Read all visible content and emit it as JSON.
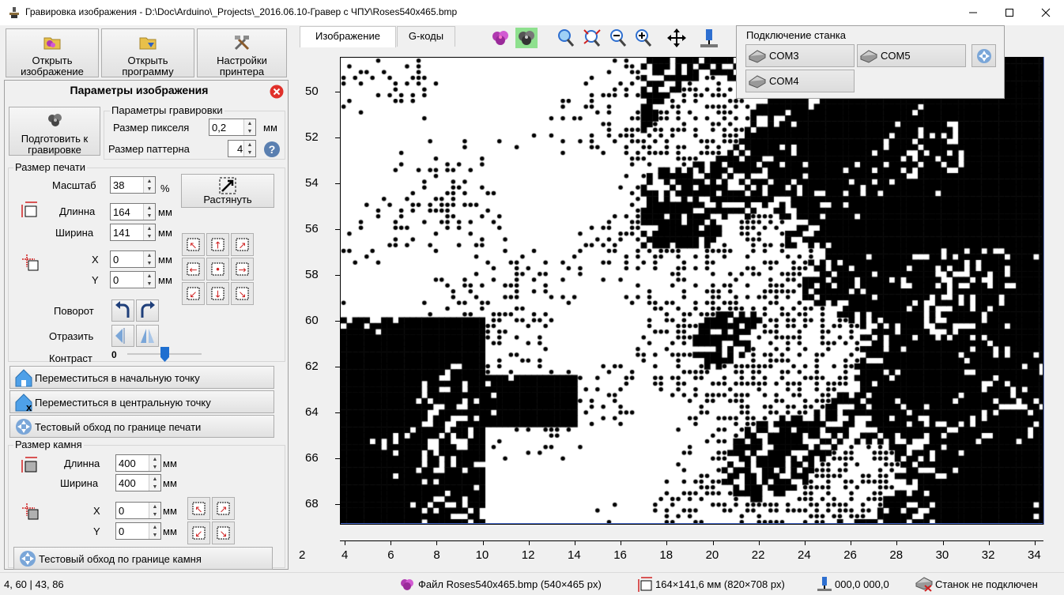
{
  "window": {
    "title": "Гравировка изображения - D:\\Doc\\Arduino\\_Projects\\_2016.06.10-Гравер с ЧПУ\\Roses540x465.bmp"
  },
  "toolbar": {
    "open_image": "Открыть изображение",
    "open_program": "Открыть программу",
    "printer_settings": "Настройки принтера"
  },
  "params": {
    "title": "Параметры изображения",
    "prepare": "Подготовить к гравировке",
    "engrave_group": "Параметры гравировки",
    "pixel_size_label": "Размер пикселя",
    "pixel_size": "0,2",
    "pixel_unit": "мм",
    "pattern_size_label": "Размер паттерна",
    "pattern_size": "4",
    "print_group": "Размер печати",
    "scale_label": "Масштаб",
    "scale": "38",
    "percent": "%",
    "stretch": "Растянуть",
    "length_label": "Длинна",
    "length": "164",
    "width_label": "Ширина",
    "width": "141",
    "mm": "мм",
    "x_label": "X",
    "x": "0",
    "y_label": "Y",
    "y": "0",
    "rotate_label": "Поворот",
    "mirror_label": "Отразить",
    "contrast_label": "Контраст",
    "contrast_value": "0",
    "contrast_level": 0.5,
    "move_start": "Переместиться в начальную точку",
    "move_center": "Переместиться в центральную точку",
    "test_print_border": "Тестовый обход по границе печати",
    "stone_group": "Размер камня",
    "stone_length_label": "Длинна",
    "stone_length": "400",
    "stone_width_label": "Ширина",
    "stone_width": "400",
    "stone_x_label": "X",
    "stone_x": "0",
    "stone_y_label": "Y",
    "stone_y": "0",
    "test_stone_border": "Тестовый обход по границе камня"
  },
  "tabs": [
    "Изображение",
    "G-коды"
  ],
  "machine": {
    "title": "Подключение станка",
    "ports": [
      "COM3",
      "COM5",
      "COM4"
    ]
  },
  "plot": {
    "x_ticks": [
      "4",
      "6",
      "8",
      "10",
      "12",
      "14",
      "16",
      "18",
      "20",
      "22",
      "24",
      "26",
      "28",
      "30",
      "32",
      "34"
    ],
    "y_ticks": [
      "50",
      "52",
      "54",
      "56",
      "58",
      "60",
      "62",
      "64",
      "66",
      "68"
    ],
    "x_edge_label": "2"
  },
  "status": {
    "coords": "4, 60  |  43, 86",
    "file": "Файл Roses540x465.bmp (540×465 px)",
    "size": "164×141,6 мм (820×708 px)",
    "position": "000,0  000,0",
    "machine_state": "Станок не подключен"
  },
  "colors": {
    "close_red": "#e0302a",
    "accent_blue": "#2e6fd0",
    "highlight_green": "#8ee08e"
  }
}
